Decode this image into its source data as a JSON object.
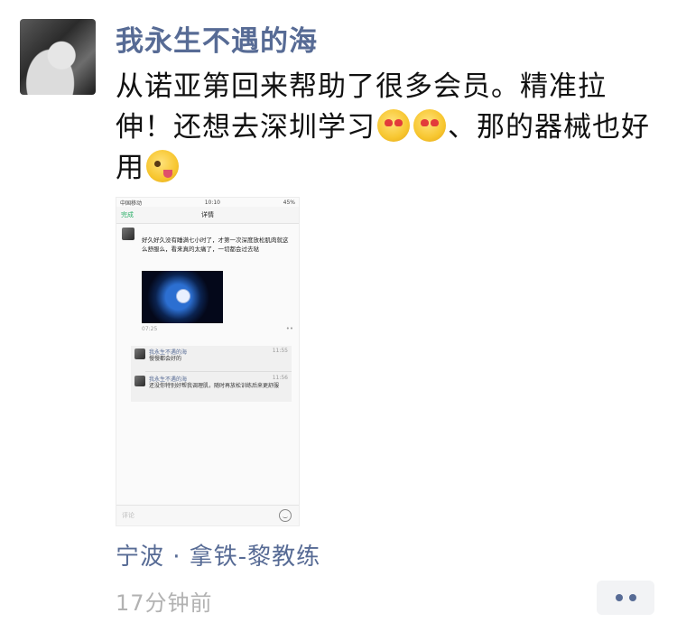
{
  "post": {
    "username": "我永生不遇的海",
    "text_part1": "从诺亚第回来帮助了很多会员。精准拉伸！还想去深圳学习",
    "text_part2": "、那的器械也好用",
    "location": "宁波 · 拿铁-黎教练",
    "timestamp": "17分钟前"
  },
  "icons": {
    "emoji_1": "heart-eyes-emoji",
    "emoji_2": "heart-eyes-emoji",
    "emoji_3": "winking-tongue-emoji",
    "more": "more-dots-icon"
  },
  "screenshot": {
    "status_left": "中国移动",
    "status_time": "10:10",
    "status_right": "45%",
    "back_label": "完成",
    "title": "详情",
    "post_text": "好久好久没有睡满七小时了，才第一次深度放松肌肉就这么舒服么，看来真的太痛了，一切都会过去哒",
    "post_time": "07:25",
    "more_label": "••",
    "comments": [
      {
        "name": "我永生不遇的海",
        "time": "11:55",
        "text": "慢慢都会好的"
      },
      {
        "name": "我永生不遇的海",
        "time": "11:56",
        "text": "还没你特别好帮我调理肌，随时再放松训练后来更舒服"
      }
    ],
    "input_placeholder": "评论"
  },
  "colors": {
    "link": "#576b95",
    "text": "#111111",
    "meta": "#b2b2b2",
    "more_bg": "#f2f3f5"
  }
}
